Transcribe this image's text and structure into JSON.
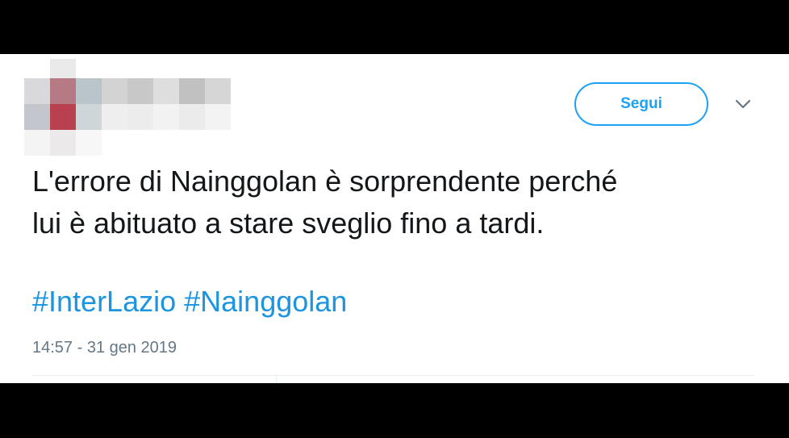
{
  "tweet": {
    "follow_label": "Segui",
    "text_line1": "L'errore di Nainggolan è sorprendente perché",
    "text_line2": "lui è abituato a stare sveglio fino a tardi.",
    "hashtags": [
      "#InterLazio",
      "#Nainggolan"
    ],
    "timestamp": "14:57 - 31 gen 2019",
    "menu_icon": "chevron-down-icon"
  },
  "colors": {
    "accent": "#1da1f2",
    "hashtag": "#1b95e0",
    "text": "#14171a",
    "muted": "#657786"
  }
}
